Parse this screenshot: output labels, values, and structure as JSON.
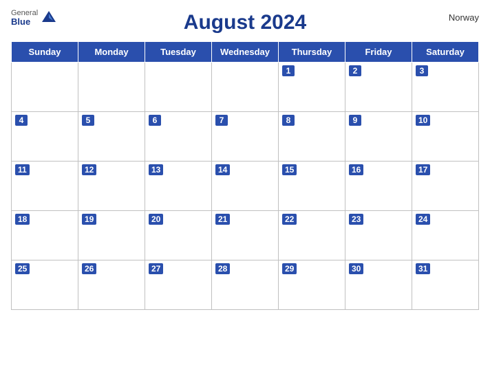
{
  "header": {
    "title": "August 2024",
    "country": "Norway",
    "logo": {
      "general": "General",
      "blue": "Blue"
    }
  },
  "weekdays": [
    "Sunday",
    "Monday",
    "Tuesday",
    "Wednesday",
    "Thursday",
    "Friday",
    "Saturday"
  ],
  "weeks": [
    [
      null,
      null,
      null,
      null,
      1,
      2,
      3
    ],
    [
      4,
      5,
      6,
      7,
      8,
      9,
      10
    ],
    [
      11,
      12,
      13,
      14,
      15,
      16,
      17
    ],
    [
      18,
      19,
      20,
      21,
      22,
      23,
      24
    ],
    [
      25,
      26,
      27,
      28,
      29,
      30,
      31
    ]
  ]
}
